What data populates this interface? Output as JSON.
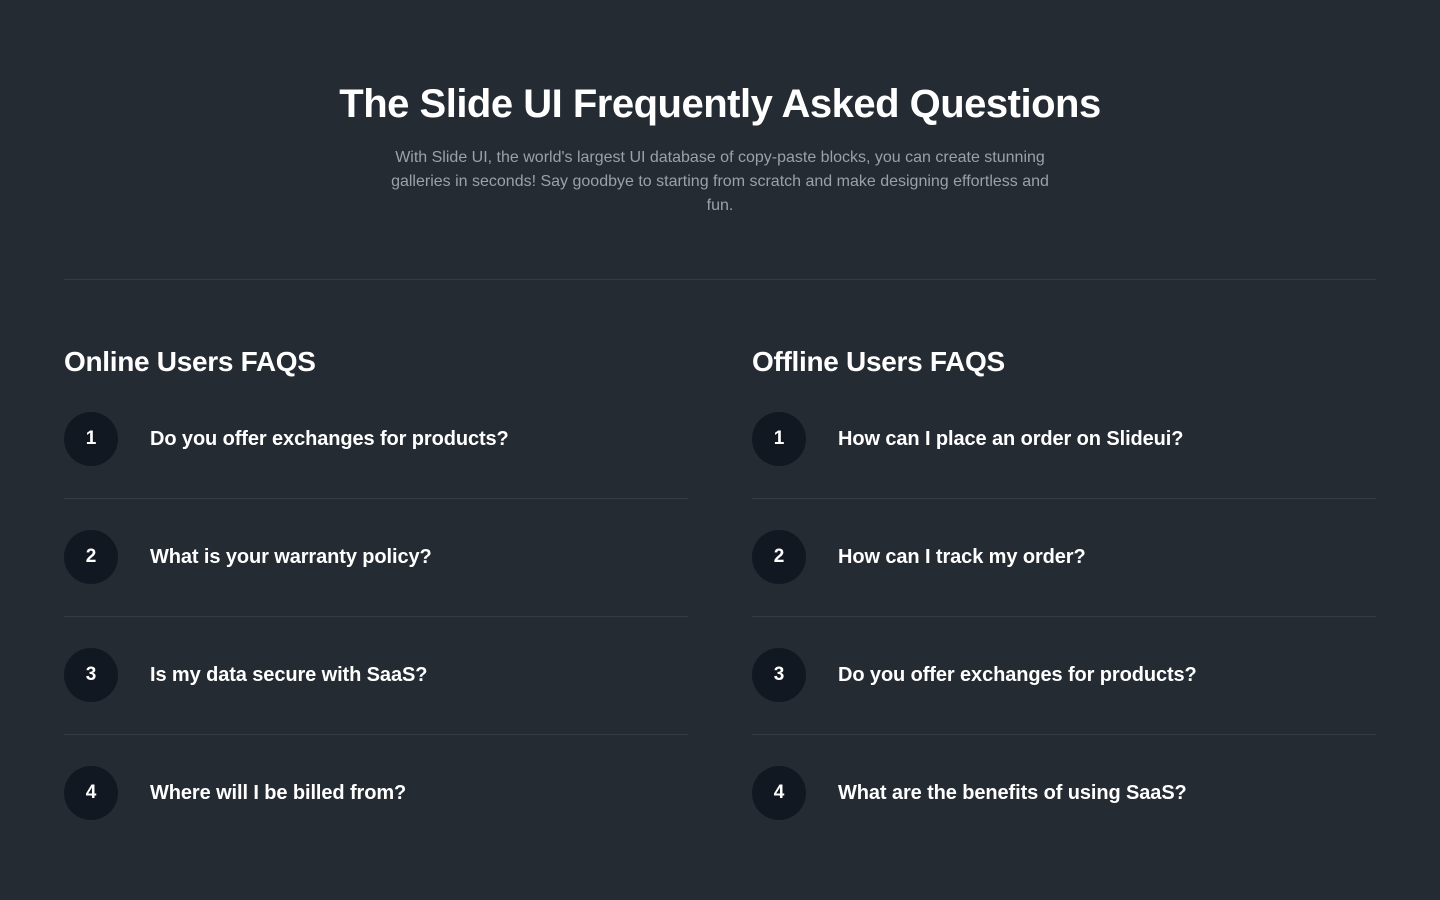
{
  "hero": {
    "title": "The Slide UI Frequently Asked Questions",
    "subtitle": "With Slide UI, the world's largest UI database of copy-paste blocks, you can create stunning galleries in seconds! Say goodbye to starting from scratch and make designing effortless and fun."
  },
  "online": {
    "heading": "Online Users FAQS",
    "items": [
      {
        "number": "1",
        "question": "Do you offer exchanges for products?"
      },
      {
        "number": "2",
        "question": "What is your warranty policy?"
      },
      {
        "number": "3",
        "question": "Is my data secure with SaaS?"
      },
      {
        "number": "4",
        "question": "Where will I be billed from?"
      }
    ]
  },
  "offline": {
    "heading": "Offline Users FAQS",
    "items": [
      {
        "number": "1",
        "question": "How can I place an order on Slideui?"
      },
      {
        "number": "2",
        "question": "How can I track my order?"
      },
      {
        "number": "3",
        "question": "Do you offer exchanges for products?"
      },
      {
        "number": "4",
        "question": "What are the benefits of using SaaS?"
      }
    ]
  },
  "colors": {
    "background": "#252b32",
    "number_badge": "#111821",
    "divider": "#353c45",
    "subtitle_text": "#9aa1aa",
    "heading_text": "#ffffff"
  }
}
